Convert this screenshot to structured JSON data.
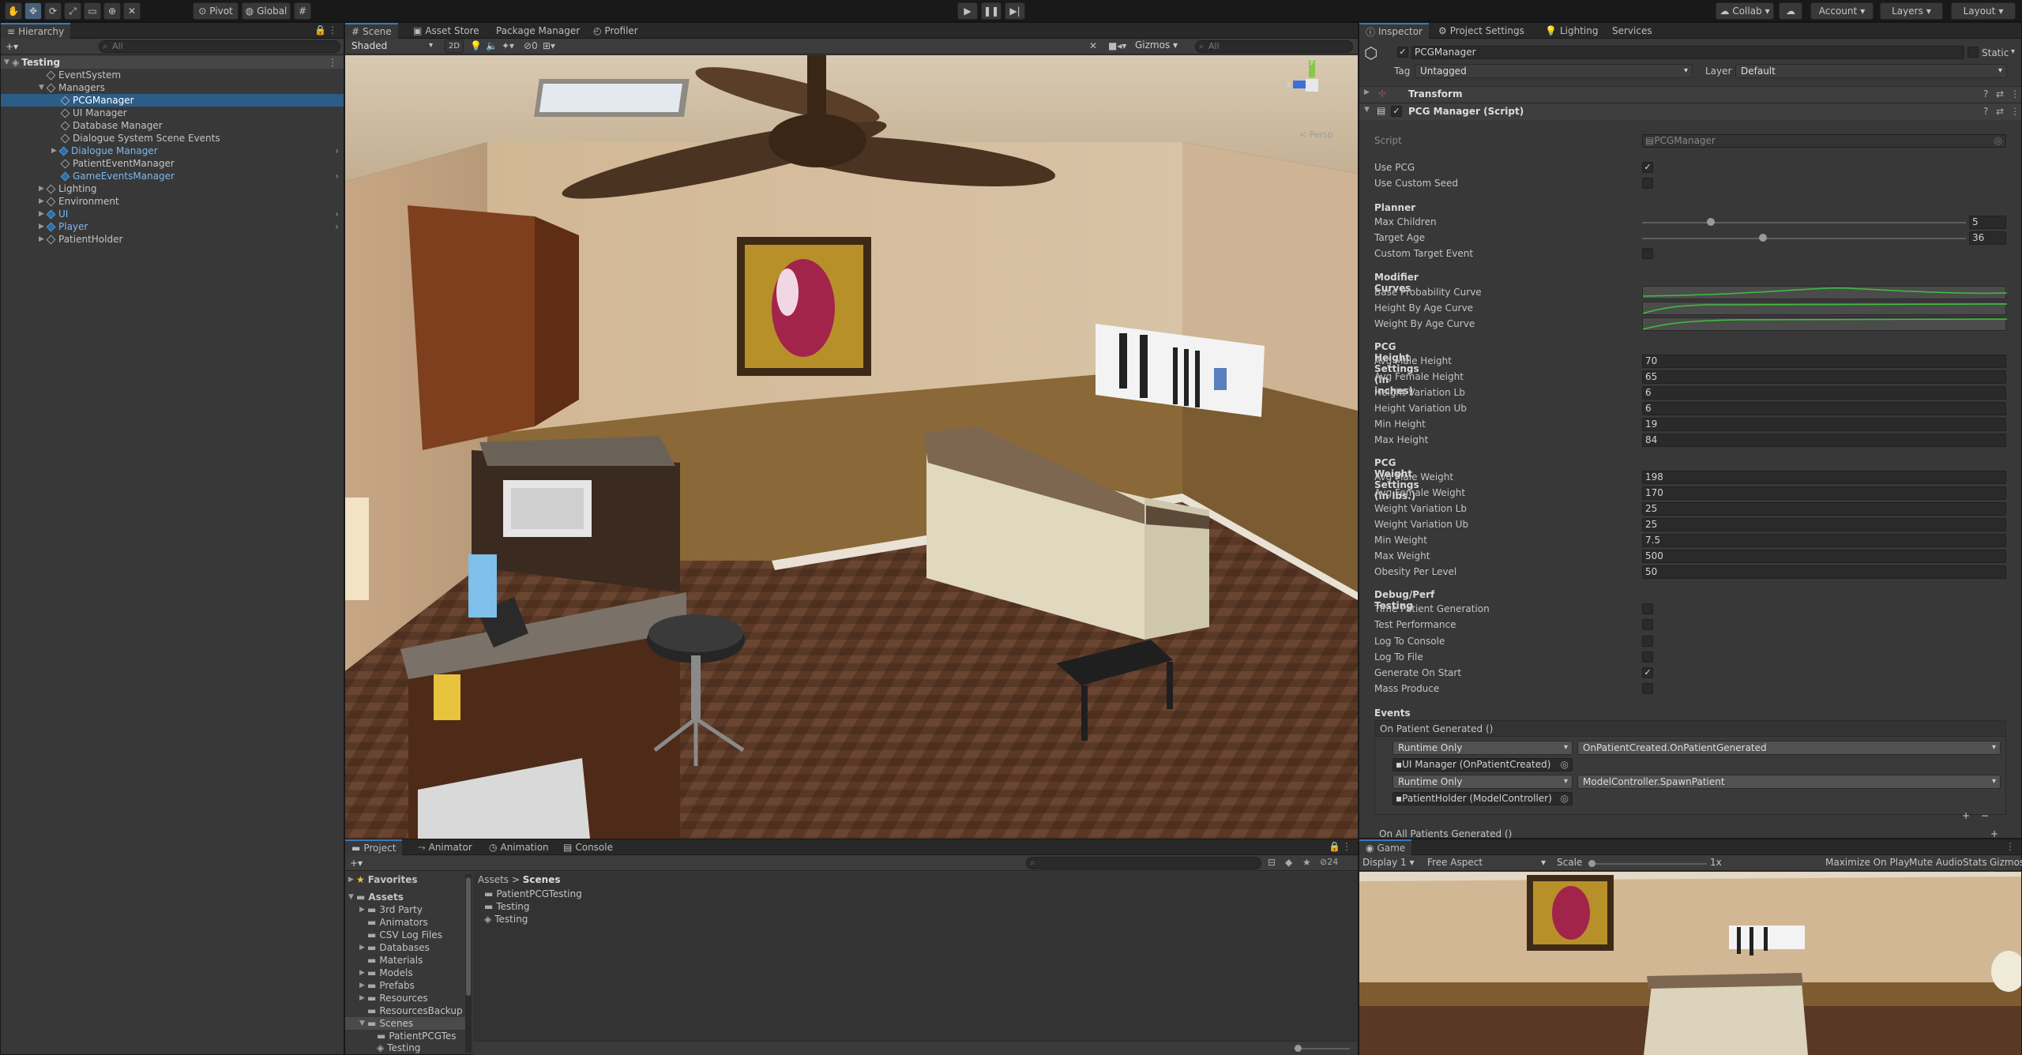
{
  "toolbar": {
    "pivot": "Pivot",
    "global": "Global",
    "collab": "Collab",
    "account": "Account",
    "layers": "Layers",
    "layout": "Layout"
  },
  "hierarchy": {
    "tab": "Hierarchy",
    "search_placeholder": "All",
    "scene": "Testing",
    "items": [
      {
        "label": "EventSystem"
      },
      {
        "label": "Managers"
      },
      {
        "label": "PCGManager"
      },
      {
        "label": "UI Manager"
      },
      {
        "label": "Database Manager"
      },
      {
        "label": "Dialogue System Scene Events"
      },
      {
        "label": "Dialogue Manager"
      },
      {
        "label": "PatientEventManager"
      },
      {
        "label": "GameEventsManager"
      },
      {
        "label": "Lighting"
      },
      {
        "label": "Environment"
      },
      {
        "label": "UI"
      },
      {
        "label": "Player"
      },
      {
        "label": "PatientHolder"
      }
    ]
  },
  "scene_view": {
    "tabs": [
      "Scene",
      "Asset Store",
      "Package Manager",
      "Profiler"
    ],
    "shading": "Shaded",
    "mode_2d": "2D",
    "hidden_count": "0",
    "gizmos": "Gizmos",
    "search_placeholder": "All",
    "persp": "< Persp",
    "axis_y": "y",
    "axis_z": "z"
  },
  "inspector": {
    "tabs": [
      "Inspector",
      "Project Settings",
      "Lighting",
      "Services"
    ],
    "object_name": "PCGManager",
    "static_label": "Static",
    "tag_label": "Tag",
    "tag_value": "Untagged",
    "layer_label": "Layer",
    "layer_value": "Default",
    "transform": "Transform",
    "component": "PCG Manager (Script)",
    "script_label": "Script",
    "script_value": "PCGManager",
    "use_pcg": "Use PCG",
    "use_custom_seed": "Use Custom Seed",
    "planner": "Planner",
    "max_children_label": "Max Children",
    "max_children": "5",
    "max_children_level": 0.2,
    "target_age_label": "Target Age",
    "target_age": "36",
    "target_age_level": 0.36,
    "custom_target_event": "Custom Target Event",
    "modifier_curves": "Modifier Curves",
    "curves": [
      "Base Probability Curve",
      "Height By Age Curve",
      "Weight By Age Curve"
    ],
    "height_header": "PCG Height Settings (in inches)",
    "height_fields": [
      {
        "label": "Avg Male Height",
        "value": "70"
      },
      {
        "label": "Avg Female Height",
        "value": "65"
      },
      {
        "label": "Height Variation Lb",
        "value": "6"
      },
      {
        "label": "Height Variation Ub",
        "value": "6"
      },
      {
        "label": "Min Height",
        "value": "19"
      },
      {
        "label": "Max Height",
        "value": "84"
      }
    ],
    "weight_header": "PCG Weight Settings (in lbs.)",
    "weight_fields": [
      {
        "label": "Avg Male Weight",
        "value": "198"
      },
      {
        "label": "Avg Female Weight",
        "value": "170"
      },
      {
        "label": "Weight Variation Lb",
        "value": "25"
      },
      {
        "label": "Weight Variation Ub",
        "value": "25"
      },
      {
        "label": "Min Weight",
        "value": "7.5"
      },
      {
        "label": "Max Weight",
        "value": "500"
      },
      {
        "label": "Obesity Per Level",
        "value": "50"
      }
    ],
    "debug_header": "Debug/Perf Testing",
    "debug_fields": [
      {
        "label": "Time Patient Generation"
      },
      {
        "label": "Test Performance"
      },
      {
        "label": "Log To Console"
      },
      {
        "label": "Log To File"
      },
      {
        "label": "Generate On Start"
      },
      {
        "label": "Mass Produce"
      }
    ],
    "events_header": "Events",
    "event1": "On Patient Generated ()",
    "runtime1": "Runtime Only",
    "function1": "OnPatientCreated.OnPatientGenerated",
    "object1": "UI Manager (OnPatientCreated)",
    "runtime2": "Runtime Only",
    "function2": "ModelController.SpawnPatient",
    "object2": "PatientHolder (ModelController)",
    "event2": "On All Patients Generated ()",
    "check": "✓"
  },
  "project": {
    "tabs": [
      "Project",
      "Animator",
      "Animation",
      "Console"
    ],
    "favorites": "Favorites",
    "assets": "Assets",
    "count": "24",
    "tree": [
      "3rd Party",
      "Animators",
      "CSV Log Files",
      "Databases",
      "Materials",
      "Models",
      "Prefabs",
      "Resources",
      "ResourcesBackup",
      "Scenes",
      "PatientPCGTes",
      "Testing"
    ],
    "breadcrumb_root": "Assets",
    "breadcrumb_current": "Scenes",
    "files": [
      "PatientPCGTesting",
      "Testing",
      "Testing"
    ]
  },
  "game": {
    "tab": "Game",
    "display": "Display 1",
    "aspect": "Free Aspect",
    "scale_label": "Scale",
    "scale_value": "1x",
    "maximize": "Maximize On Play",
    "mute": "Mute Audio",
    "stats": "Stats",
    "gizmos": "Gizmos"
  },
  "colors": {
    "accent": "#3a79bb",
    "selection": "#2c5d87",
    "panel": "#383838",
    "wall": "#cdb08f",
    "floor": "#5a3826"
  }
}
